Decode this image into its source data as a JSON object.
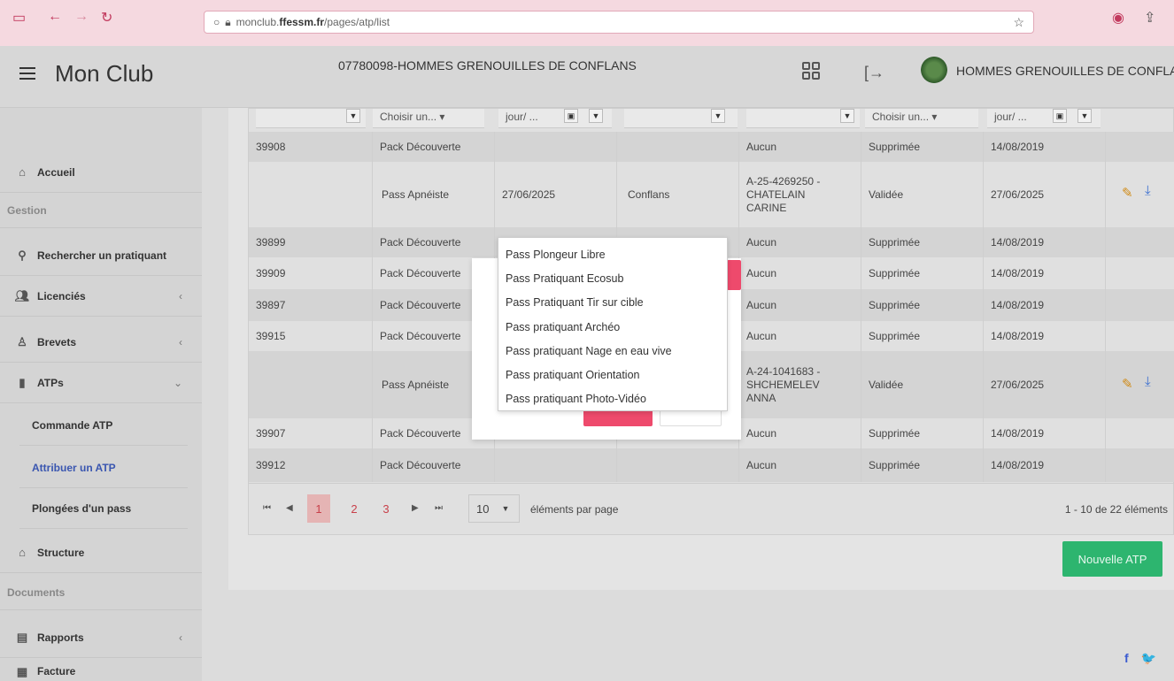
{
  "browser": {
    "url_prefix": "monclub.",
    "url_domain": "ffessm.fr",
    "url_path": "/pages/atp/list"
  },
  "header": {
    "app_title": "Mon Club",
    "club_code": "07780098-HOMMES GRENOUILLES DE CONFLANS",
    "club_name": "HOMMES GRENOUILLES DE CONFLANS"
  },
  "sidebar": {
    "accueil": "Accueil",
    "gestion": "Gestion",
    "rechercher": "Rechercher un pratiquant",
    "licencies": "Licenciés",
    "brevets": "Brevets",
    "atps": "ATPs",
    "commande": "Commande ATP",
    "attribuer": "Attribuer un ATP",
    "plongees": "Plongées d'un pass",
    "structure": "Structure",
    "documents": "Documents",
    "rapports": "Rapports",
    "facture": "Facture"
  },
  "filters": {
    "choose": "Choisir un...",
    "date": "jour/ ..."
  },
  "rows": [
    {
      "num": "39908",
      "type": "Pack Découverte",
      "date": "",
      "lieu": "",
      "pratiquant": "Aucun",
      "statut": "Supprimée",
      "date2": "14/08/2019"
    },
    {
      "num": "",
      "type": "Pass Apnéiste",
      "date": "27/06/2025",
      "lieu": "Conflans",
      "pratiquant": "A-25-4269250 - CHATELAIN CARINE",
      "statut": "Validée",
      "date2": "27/06/2025"
    },
    {
      "num": "39899",
      "type": "Pack Découverte",
      "date": "",
      "lieu": "",
      "pratiquant": "Aucun",
      "statut": "Supprimée",
      "date2": "14/08/2019"
    },
    {
      "num": "39909",
      "type": "Pack Découverte",
      "date": "",
      "lieu": "",
      "pratiquant": "Aucun",
      "statut": "Supprimée",
      "date2": "14/08/2019"
    },
    {
      "num": "39897",
      "type": "Pack Découverte",
      "date": "",
      "lieu": "",
      "pratiquant": "Aucun",
      "statut": "Supprimée",
      "date2": "14/08/2019"
    },
    {
      "num": "39915",
      "type": "Pack Découverte",
      "date": "",
      "lieu": "",
      "pratiquant": "Aucun",
      "statut": "Supprimée",
      "date2": "14/08/2019"
    },
    {
      "num": "",
      "type": "Pass Apnéiste",
      "date": "",
      "lieu": "",
      "pratiquant": "A-24-1041683 - SHCHEMELEV ANNA",
      "statut": "Validée",
      "date2": "27/06/2025"
    },
    {
      "num": "39907",
      "type": "Pack Découverte",
      "date": "",
      "lieu": "",
      "pratiquant": "Aucun",
      "statut": "Supprimée",
      "date2": "14/08/2019"
    },
    {
      "num": "39912",
      "type": "Pack Découverte",
      "date": "",
      "lieu": "",
      "pratiquant": "Aucun",
      "statut": "Supprimée",
      "date2": "14/08/2019"
    }
  ],
  "pager": {
    "pages": [
      "1",
      "2",
      "3"
    ],
    "page_size": "10",
    "per_page_label": "éléments par page",
    "count": "1 - 10 de 22 éléments"
  },
  "new_button": "Nouvelle ATP",
  "dropdown_options": [
    "Pass Plongeur Libre",
    "Pass Pratiquant Ecosub",
    "Pass Pratiquant Tir sur cible",
    "Pass pratiquant Archéo",
    "Pass pratiquant Nage en eau vive",
    "Pass pratiquant Orientation",
    "Pass pratiquant Photo-Vidéo"
  ],
  "social": {
    "facebook": "f",
    "twitter": "🐦"
  }
}
